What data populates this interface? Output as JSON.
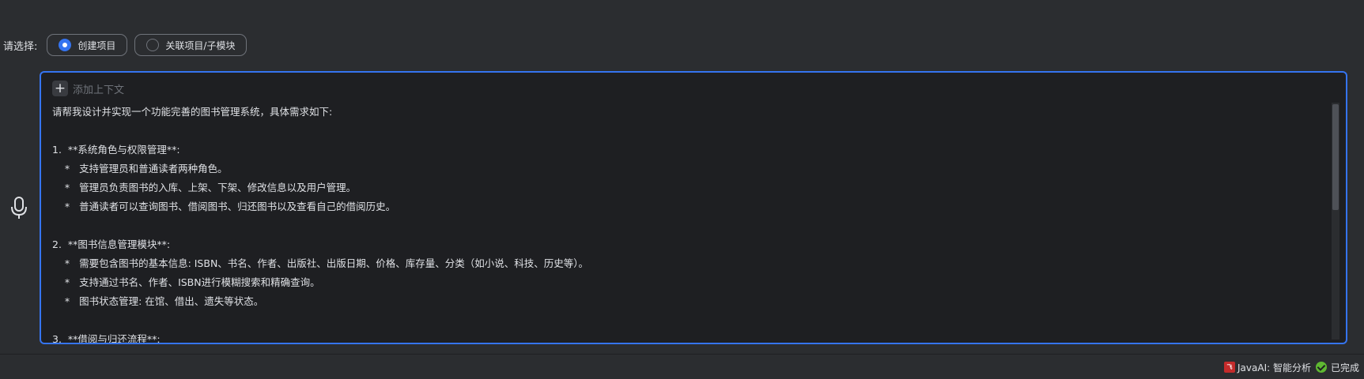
{
  "selector": {
    "label": "请选择:",
    "options": [
      {
        "label": "创建项目",
        "selected": true
      },
      {
        "label": "关联项目/子模块",
        "selected": false
      }
    ]
  },
  "input": {
    "add_context_label": "添加上下文",
    "lines": [
      "请帮我设计并实现一个功能完善的图书管理系统，具体需求如下:",
      "",
      "1.  **系统角色与权限管理**:",
      "    *   支持管理员和普通读者两种角色。",
      "    *   管理员负责图书的入库、上架、下架、修改信息以及用户管理。",
      "    *   普通读者可以查询图书、借阅图书、归还图书以及查看自己的借阅历史。",
      "",
      "2.  **图书信息管理模块**:",
      "    *   需要包含图书的基本信息: ISBN、书名、作者、出版社、出版日期、价格、库存量、分类（如小说、科技、历史等）。",
      "    *   支持通过书名、作者、ISBN进行模糊搜索和精确查询。",
      "    *   图书状态管理: 在馆、借出、遗失等状态。",
      "",
      "3.  **借阅与归还流程**:"
    ]
  },
  "status_bar": {
    "plugin_label": "JavaAI: 智能分析",
    "state_label": "已完成"
  },
  "colors": {
    "accent": "#3574f0",
    "success": "#5fb832",
    "background": "#2b2d30",
    "editor_background": "#1e1f22"
  }
}
